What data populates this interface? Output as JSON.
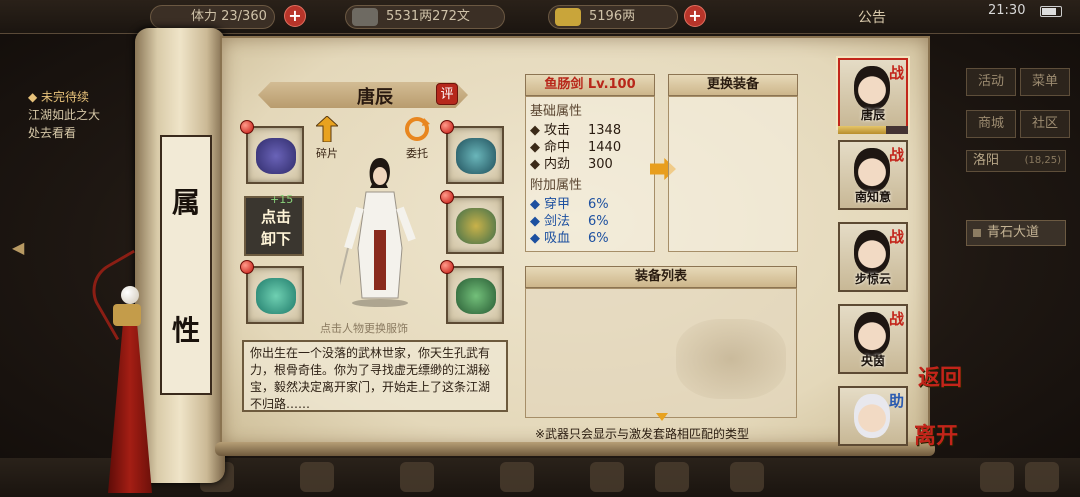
{
  "topbar": {
    "stamina": "体力 23/360",
    "money": "5531两272文",
    "gold": "5196两",
    "notice": "公告",
    "time": "21:30"
  },
  "left": {
    "quest_title": "◆ 未完待续",
    "quest_text_1": "江湖如此之大",
    "quest_text_2": "处去看看"
  },
  "side_tab": {
    "char1": "属",
    "char2": "性"
  },
  "character": {
    "name": "唐辰",
    "rate_label": "评",
    "hint": "点击人物更换服饰",
    "unequip_line1": "点击",
    "unequip_line2": "卸下",
    "enhance": "+15",
    "action_fragment": "碎片",
    "action_delegate": "委托",
    "bio": "你出生在一个没落的武林世家，你天生孔武有力，根骨奇佳。你为了寻找虚无缥缈的江湖秘宝，毅然决定离开家门，开始走上了这条江湖不归路……"
  },
  "weapon": {
    "title": "鱼肠剑 Lv.100",
    "base_header": "基础属性",
    "base_stats": [
      {
        "label": "攻击",
        "value": "1348"
      },
      {
        "label": "命中",
        "value": "1440"
      },
      {
        "label": "内劲",
        "value": "300"
      }
    ],
    "extra_header": "附加属性",
    "extra_stats": [
      {
        "label": "穿甲",
        "value": "6%"
      },
      {
        "label": "剑法",
        "value": "6%"
      },
      {
        "label": "吸血",
        "value": "6%"
      }
    ]
  },
  "change_equip": {
    "title": "更换装备"
  },
  "equip_list": {
    "title": "装备列表",
    "note": "※武器只会显示与激发套路相匹配的类型"
  },
  "party": [
    {
      "name": "唐辰",
      "tag": "战"
    },
    {
      "name": "南知意",
      "tag": "战"
    },
    {
      "name": "步惊云",
      "tag": "战"
    },
    {
      "name": "央茵",
      "tag": "战"
    },
    {
      "name": "",
      "tag": "助"
    }
  ],
  "controls": {
    "back": "返回",
    "leave": "离开"
  },
  "right_panel": {
    "activity": "活动",
    "menu": "菜单",
    "shop": "商城",
    "community": "社区",
    "city": "洛阳",
    "coords": "(18,25)",
    "road": "青石大道"
  },
  "colors": {
    "accent_red": "#c2261a",
    "arrow_orange": "#e89e1e",
    "stat_blue": "#1d50a0"
  }
}
